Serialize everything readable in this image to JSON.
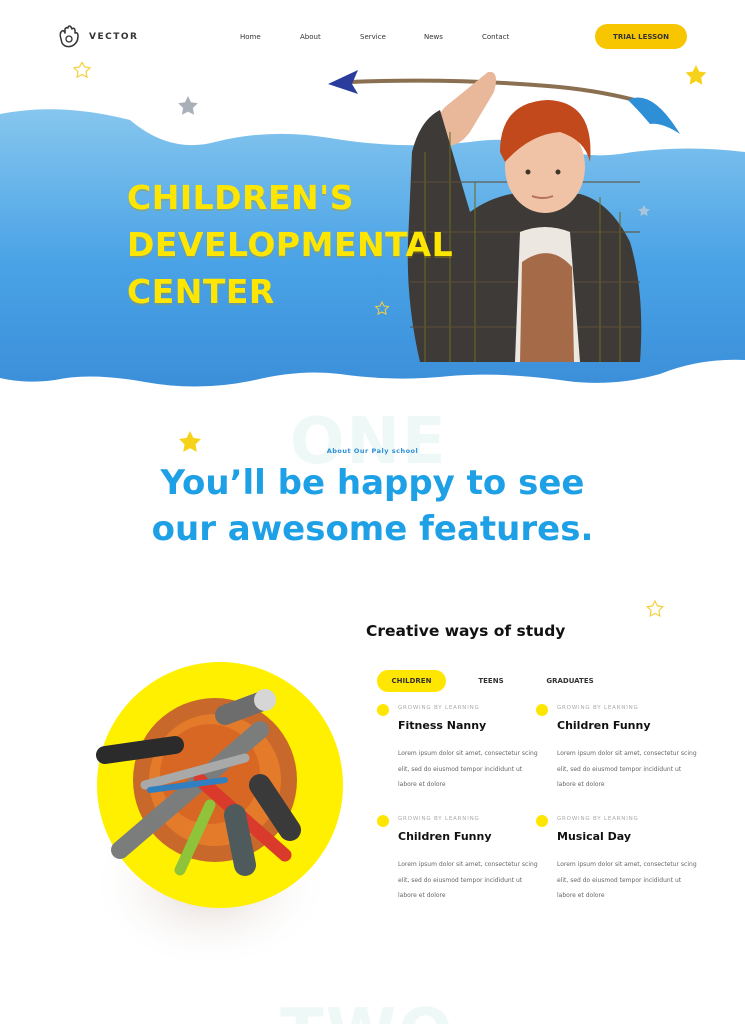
{
  "nav": {
    "logo_text": "VECTOR",
    "links": [
      "Home",
      "About",
      "Service",
      "News",
      "Contact"
    ],
    "cta": "TRIAL LESSON"
  },
  "hero": {
    "title_lines": [
      "CHILDREN'S",
      "DEVELOPMENTAL",
      "CENTER"
    ]
  },
  "about": {
    "bg_word": "ONE",
    "label": "About Our Paly school",
    "title_lines": [
      "You’ll be happy to see",
      "our awesome features."
    ]
  },
  "study": {
    "title": "Creative ways of study",
    "tabs": [
      "CHILDREN",
      "TEENS",
      "GRADUATES"
    ],
    "active_tab": "CHILDREN",
    "features": [
      {
        "kicker": "GROWING BY LEARNING",
        "title": "Fitness  Nanny",
        "text": "Lorem ipsum dolor sit amet, consectetur scing elit, sed do eiusmod tempor incididunt ut labore et dolore"
      },
      {
        "kicker": "GROWING BY LEARNING",
        "title": "Children Funny",
        "text": "Lorem ipsum dolor sit amet, consectetur scing elit, sed do eiusmod tempor incididunt ut labore et dolore"
      },
      {
        "kicker": "GROWING BY LEARNING",
        "title": "Children Funny",
        "text": "Lorem ipsum dolor sit amet, consectetur scing elit, sed do eiusmod tempor incididunt ut labore et dolore"
      },
      {
        "kicker": "GROWING BY LEARNING",
        "title": "Musical Day",
        "text": "Lorem ipsum dolor sit amet, consectetur scing elit, sed do eiusmod tempor incididunt ut labore et dolore"
      }
    ]
  },
  "footer_ghost": "TWO",
  "colors": {
    "accent_yellow": "#ffe600",
    "cta_yellow": "#f7c600",
    "sky_blue": "#1ea0e6",
    "cloud_blue": "#4aa3e6"
  }
}
